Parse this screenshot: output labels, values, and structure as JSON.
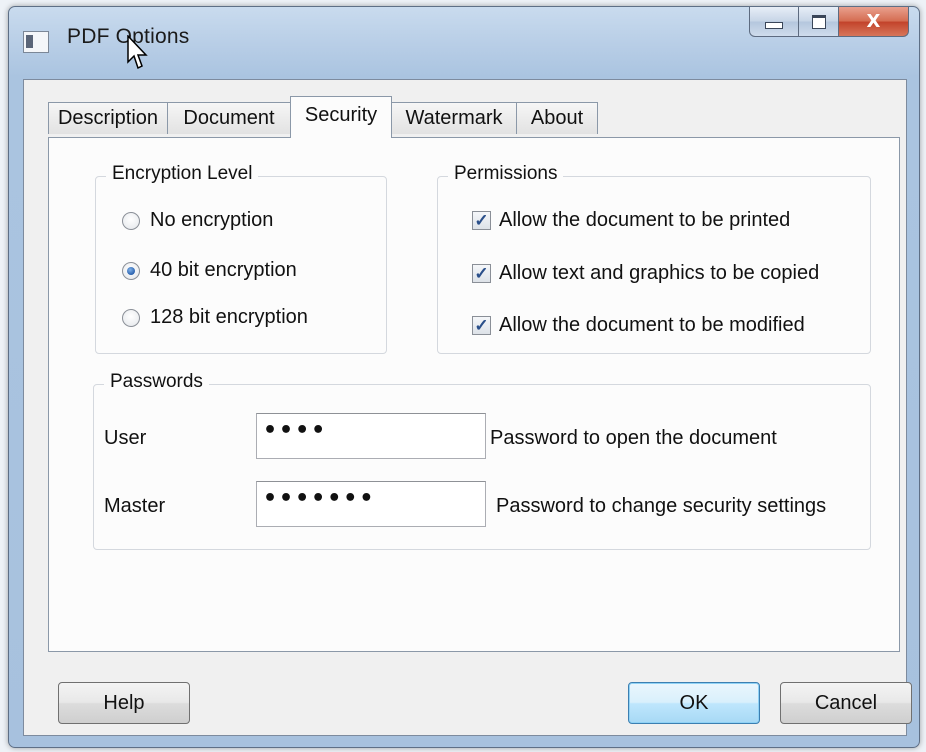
{
  "window": {
    "title": "PDF Options"
  },
  "titlebar_buttons": {
    "close_glyph": "X"
  },
  "tabs": [
    {
      "label": "Description",
      "active": false
    },
    {
      "label": "Document",
      "active": false
    },
    {
      "label": "Security",
      "active": true
    },
    {
      "label": "Watermark",
      "active": false
    },
    {
      "label": "About",
      "active": false
    }
  ],
  "encryption": {
    "title": "Encryption Level",
    "options": [
      {
        "label": "No encryption",
        "selected": false
      },
      {
        "label": "40 bit encryption",
        "selected": true
      },
      {
        "label": "128 bit encryption",
        "selected": false
      }
    ]
  },
  "permissions": {
    "title": "Permissions",
    "items": [
      {
        "label": "Allow the document to be printed",
        "checked": true
      },
      {
        "label": "Allow text and graphics to be copied",
        "checked": true
      },
      {
        "label": "Allow the document to be modified",
        "checked": true
      }
    ]
  },
  "passwords": {
    "title": "Passwords",
    "user": {
      "label": "User",
      "value": "••••",
      "hint": "Password to open the document"
    },
    "master": {
      "label": "Master",
      "value": "•••••••",
      "hint": "Password to change security settings"
    }
  },
  "buttons": {
    "help": "Help",
    "ok": "OK",
    "cancel": "Cancel"
  },
  "colors": {
    "accent": "#3c7fb1",
    "close": "#c2422a"
  }
}
